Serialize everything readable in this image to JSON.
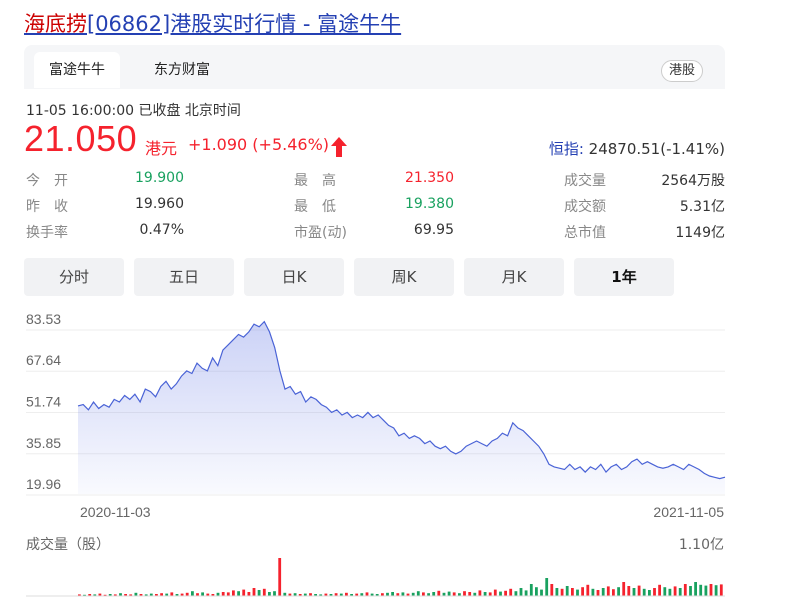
{
  "header": {
    "title_highlight": "海底捞",
    "title_rest": "[06862]港股实时行情 - 富途牛牛"
  },
  "tabs": [
    {
      "label": "富途牛牛",
      "active": true
    },
    {
      "label": "东方财富",
      "active": false
    }
  ],
  "market_badge": "港股",
  "time_info": "11-05 16:00:00  已收盘  北京时间",
  "quote": {
    "price": "21.050",
    "currency": "港元",
    "change": "+1.090 (+5.46%)",
    "index_label": "恒指:",
    "index_value": "24870.51(-1.41%)"
  },
  "stats": [
    {
      "label": "今　开",
      "value": "19.900",
      "color": "green"
    },
    {
      "label": "最　高",
      "value": "21.350",
      "color": "red"
    },
    {
      "label": "成交量",
      "value": "2564万股",
      "color": ""
    },
    {
      "label": "昨　收",
      "value": "19.960",
      "color": ""
    },
    {
      "label": "最　低",
      "value": "19.380",
      "color": "green"
    },
    {
      "label": "成交额",
      "value": "5.31亿",
      "color": ""
    },
    {
      "label": "换手率",
      "value": "0.47%",
      "color": ""
    },
    {
      "label": "市盈(动)",
      "value": "69.95",
      "color": ""
    },
    {
      "label": "总市值",
      "value": "1149亿",
      "color": ""
    }
  ],
  "periods": [
    {
      "label": "分时",
      "active": false
    },
    {
      "label": "五日",
      "active": false
    },
    {
      "label": "日K",
      "active": false
    },
    {
      "label": "周K",
      "active": false
    },
    {
      "label": "月K",
      "active": false
    },
    {
      "label": "1年",
      "active": true
    }
  ],
  "colors": {
    "red": "#f5222d",
    "green": "#19a15f",
    "line": "#4a63d6",
    "link": "#2440b3"
  },
  "chart_data": {
    "type": "area",
    "y_ticks": [
      "83.53",
      "67.64",
      "51.74",
      "35.85",
      "19.96"
    ],
    "ylim": [
      19.96,
      83.53
    ],
    "x_labels": [
      "2020-11-03",
      "2021-11-05"
    ],
    "values": [
      48.5,
      49,
      47,
      50,
      47.5,
      49,
      48,
      51,
      50,
      52.5,
      51,
      53,
      50,
      55,
      54,
      52,
      56,
      58,
      55,
      57,
      60,
      62,
      61,
      65,
      63,
      62,
      67,
      64,
      70,
      72,
      74,
      76,
      75,
      77,
      80,
      79,
      81,
      77,
      71,
      62,
      55,
      56,
      53,
      54,
      50,
      52,
      51,
      49,
      48,
      46,
      47,
      45,
      46,
      44,
      45,
      44,
      46,
      44,
      45,
      43,
      41,
      40,
      37,
      38,
      36,
      37,
      36,
      34,
      35,
      33,
      32,
      33,
      31,
      30,
      31,
      33,
      34,
      35,
      34,
      33,
      35,
      36,
      38,
      37,
      42,
      40,
      39,
      37,
      35,
      33,
      30,
      26,
      25,
      24.5,
      24,
      26,
      24,
      25,
      23,
      25,
      24,
      26,
      23,
      25,
      26,
      24,
      25,
      27,
      28,
      26,
      27,
      26,
      25,
      24.5,
      25,
      26,
      25,
      24,
      26,
      25,
      24,
      22.5,
      21.5,
      21,
      20.5,
      21.05
    ],
    "volume_label": "成交量（股）",
    "volume_max": "1.10亿",
    "volumes": [
      0.04,
      0.03,
      0.05,
      0.04,
      0.06,
      0.03,
      0.05,
      0.04,
      0.07,
      0.05,
      0.04,
      0.08,
      0.05,
      0.04,
      0.06,
      0.05,
      0.07,
      0.06,
      0.09,
      0.05,
      0.06,
      0.08,
      0.12,
      0.07,
      0.09,
      0.06,
      0.05,
      0.08,
      0.1,
      0.09,
      0.14,
      0.12,
      0.16,
      0.1,
      0.2,
      0.15,
      0.18,
      0.1,
      0.12,
      0.95,
      0.08,
      0.06,
      0.07,
      0.05,
      0.06,
      0.07,
      0.05,
      0.04,
      0.06,
      0.05,
      0.07,
      0.06,
      0.08,
      0.05,
      0.06,
      0.07,
      0.09,
      0.06,
      0.05,
      0.07,
      0.08,
      0.1,
      0.07,
      0.09,
      0.06,
      0.08,
      0.12,
      0.09,
      0.07,
      0.1,
      0.13,
      0.08,
      0.11,
      0.09,
      0.07,
      0.12,
      0.1,
      0.08,
      0.14,
      0.1,
      0.09,
      0.16,
      0.11,
      0.13,
      0.18,
      0.12,
      0.2,
      0.14,
      0.3,
      0.22,
      0.16,
      0.45,
      0.3,
      0.2,
      0.18,
      0.25,
      0.2,
      0.16,
      0.22,
      0.28,
      0.18,
      0.15,
      0.2,
      0.24,
      0.17,
      0.22,
      0.35,
      0.25,
      0.2,
      0.26,
      0.18,
      0.15,
      0.2,
      0.28,
      0.22,
      0.18,
      0.24,
      0.2,
      0.3,
      0.25,
      0.35,
      0.28,
      0.26,
      0.3,
      0.27,
      0.29
    ],
    "volume_up": [
      1,
      0,
      1,
      0,
      1,
      1,
      0,
      1,
      0,
      1,
      1,
      0,
      1,
      0,
      0,
      1,
      1,
      0,
      1,
      0,
      1,
      1,
      0,
      1,
      0,
      1,
      1,
      0,
      1,
      1,
      1,
      0,
      1,
      1,
      1,
      0,
      1,
      0,
      0,
      1,
      0,
      1,
      0,
      1,
      0,
      1,
      0,
      0,
      1,
      0,
      1,
      0,
      1,
      0,
      1,
      0,
      1,
      0,
      0,
      1,
      0,
      0,
      1,
      0,
      1,
      0,
      0,
      1,
      0,
      0,
      1,
      0,
      0,
      1,
      0,
      1,
      1,
      0,
      1,
      0,
      1,
      1,
      0,
      1,
      1,
      0,
      0,
      0,
      0,
      0,
      0,
      0,
      1,
      0,
      1,
      0,
      1,
      0,
      1,
      1,
      0,
      1,
      0,
      1,
      1,
      0,
      1,
      1,
      0,
      1,
      0,
      0,
      1,
      1,
      0,
      0,
      1,
      0,
      1,
      0,
      0,
      0,
      0,
      1,
      0,
      1
    ]
  }
}
